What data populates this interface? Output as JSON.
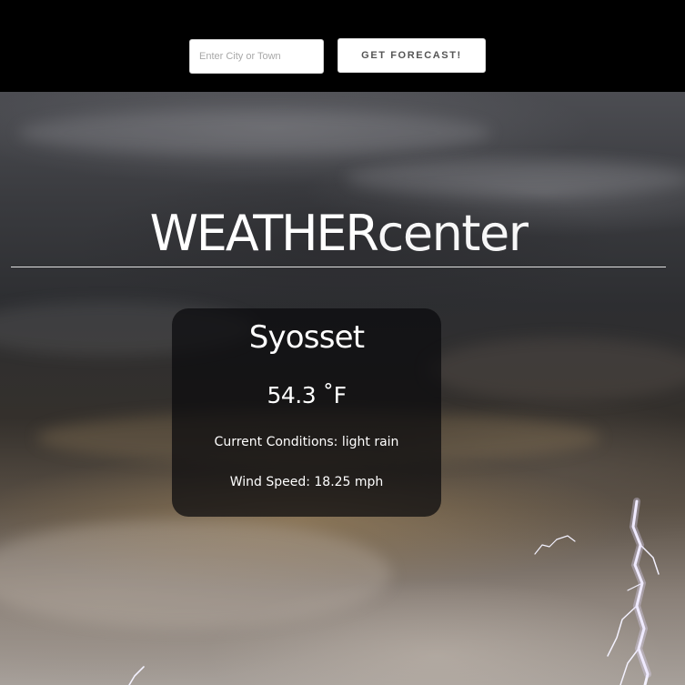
{
  "search": {
    "placeholder": "Enter City or Town",
    "value": ""
  },
  "toolbar": {
    "forecast_label": "GET FORECAST!"
  },
  "header": {
    "title_strong": "WEATHER",
    "title_light": "center"
  },
  "weather": {
    "city": "Syosset",
    "temperature": "54.3 ˚F",
    "conditions": "Current Conditions: light rain",
    "wind": "Wind Speed: 18.25 mph"
  },
  "colors": {
    "topbar": "#000000",
    "card_background": "rgba(10,10,12,0.72)",
    "text": "#ffffff"
  },
  "icons": {
    "background": "storm-clouds-lightning-image"
  }
}
